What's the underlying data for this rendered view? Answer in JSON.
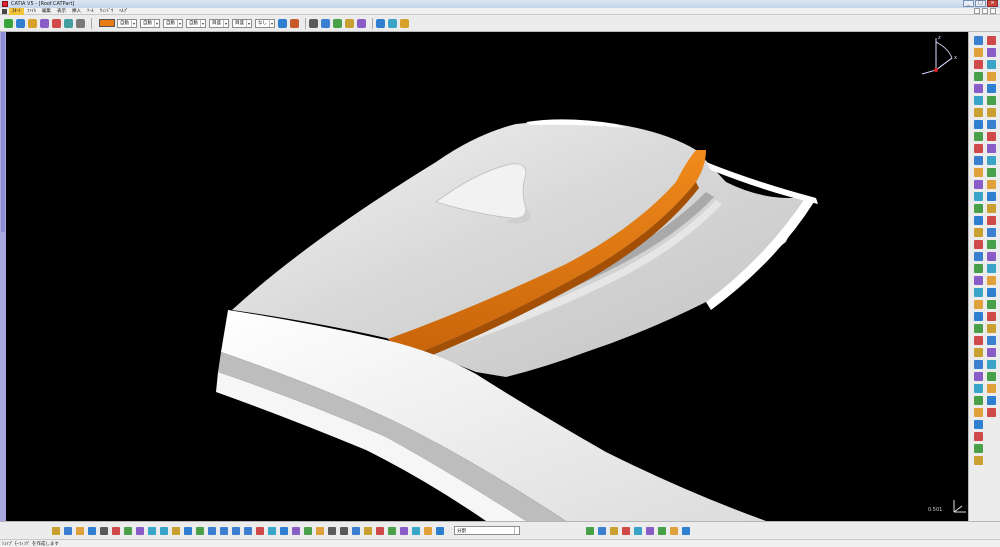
{
  "window": {
    "title": "CATIA V5 - [Roof.CATPart]",
    "controls": {
      "minimize": "_",
      "maximize": "□",
      "close": "×"
    }
  },
  "menubar": {
    "items": [
      "ｽﾀｰﾄ",
      "ﾌｧｲﾙ",
      "編集",
      "表示",
      "挿入",
      "ﾂｰﾙ",
      "ｳｨﾝﾄﾞｳ",
      "ﾍﾙﾌﾟ"
    ]
  },
  "toolbar": {
    "color_swatch": "#e87b12",
    "combos": [
      "自動",
      "自動",
      "自動",
      "自動",
      "目盛",
      "目盛",
      "なし"
    ]
  },
  "viewport": {
    "background": "#000000",
    "zoom_readout": "0.501",
    "highlight_color": "#e87b12"
  },
  "compass_axes": {
    "z": "z",
    "x": "x"
  },
  "bottombar": {
    "combo_value": "分割"
  },
  "status": {
    "message": "ｼｪｲﾌﾟ ﾓｰﾌｨﾝｸﾞ を作成します"
  },
  "icons": {
    "left_toolbar": [
      "move-icon",
      "pointer-icon",
      "color-icon"
    ],
    "right_toolbar": [
      "sketcher-icon",
      "extrude-icon",
      "revolve-icon",
      "sweep-icon",
      "blend-icon",
      "fill-icon",
      "offset-icon",
      "join-icon",
      "split-icon",
      "trim-icon",
      "fillet-icon",
      "chamfer-icon",
      "transform-icon",
      "measure-icon"
    ]
  }
}
